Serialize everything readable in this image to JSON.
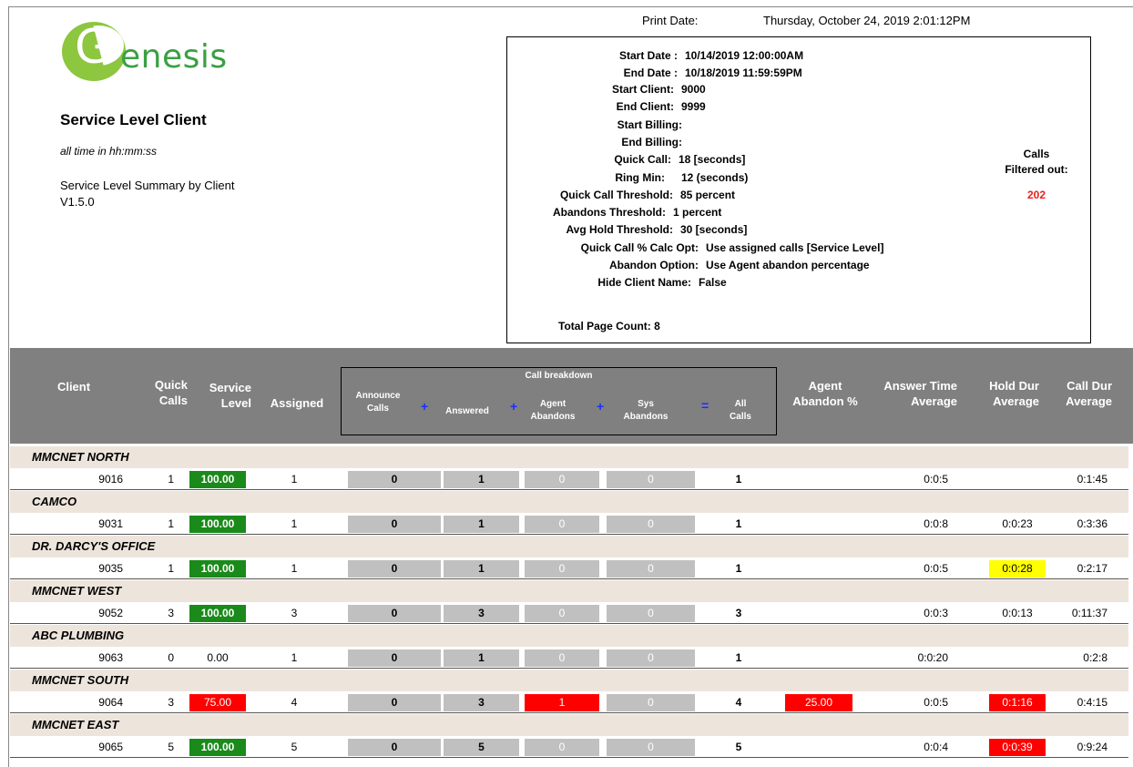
{
  "print": {
    "label": "Print Date:",
    "value": "Thursday, October 24, 2019   2:01:12PM"
  },
  "brand": {
    "logo_letter": "G",
    "logo_text": "enesis",
    "logo_color": "#8dc63f"
  },
  "report": {
    "title": "Service Level Client",
    "time_note": "all time in hh:mm:ss",
    "summary": "Service Level Summary by Client",
    "version": "V1.5.0"
  },
  "params": {
    "start_date": {
      "label": "Start Date :",
      "value": "10/14/2019  12:00:00AM"
    },
    "end_date": {
      "label": "End Date :",
      "value": "10/18/2019  11:59:59PM"
    },
    "start_client": {
      "label": "Start Client:",
      "value": "9000"
    },
    "end_client": {
      "label": "End Client:",
      "value": "9999"
    },
    "start_billing": {
      "label": "Start Billing:",
      "value": ""
    },
    "end_billing": {
      "label": "End Billing:",
      "value": ""
    },
    "quick_call": {
      "label": "Quick Call:",
      "value": "18 [seconds]"
    },
    "ring_min": {
      "label": "Ring Min:",
      "value": "12 (seconds)"
    },
    "quick_call_threshold": {
      "label": "Quick Call Threshold:",
      "value": "85 percent"
    },
    "abandons_threshold": {
      "label": "Abandons Threshold:",
      "value": "1 percent"
    },
    "avg_hold_threshold": {
      "label": "Avg Hold Threshold:",
      "value": "30 [seconds]"
    },
    "quick_call_calc_opt": {
      "label": "Quick Call % Calc Opt:",
      "value": "Use assigned calls [Service Level]"
    },
    "abandon_option": {
      "label": "Abandon Option:",
      "value": "Use Agent abandon percentage"
    },
    "hide_client_name": {
      "label": "Hide Client Name:",
      "value": "False"
    },
    "calls_filtered_line1": "Calls",
    "calls_filtered_line2": "Filtered out:",
    "calls_filtered_count": "202",
    "total_page_count_label": "Total Page Count:",
    "total_page_count": "8"
  },
  "columns": {
    "client": "Client",
    "quick_calls_1": "Quick",
    "quick_calls_2": "Calls",
    "service_level_1": "Service",
    "service_level_2": "Level",
    "assigned": "Assigned",
    "breakdown_title": "Call breakdown",
    "announce_1": "Announce",
    "announce_2": "Calls",
    "answered": "Answered",
    "agent_ab_1": "Agent",
    "agent_ab_2": "Abandons",
    "sys_ab_1": "Sys",
    "sys_ab_2": "Abandons",
    "all_1": "All",
    "all_2": "Calls",
    "plus": "+",
    "equals": "=",
    "agent_abandon_pct_1": "Agent",
    "agent_abandon_pct_2": "Abandon %",
    "answer_time_1": "Answer Time",
    "answer_time_2": "Average",
    "hold_dur_1": "Hold Dur",
    "hold_dur_2": "Average",
    "call_dur_1": "Call Dur",
    "call_dur_2": "Average"
  },
  "colors": {
    "good": "#1a8a1a",
    "bad": "#ff0000",
    "warn": "#ffff00",
    "header": "#808080",
    "group": "#ede5dc"
  },
  "groups": [
    {
      "name": "MMCNET NORTH",
      "client": "9016",
      "quick": "1",
      "service_level": "100.00",
      "sl_status": "good",
      "assigned": "1",
      "announce": "0",
      "answered": "1",
      "agent_ab": "0",
      "sys_ab": "0",
      "all": "1",
      "agent_ab_pct": "",
      "aap_status": "none",
      "answer_time": "0:0:5",
      "hold_dur": "",
      "hold_status": "none",
      "call_dur": "0:1:45"
    },
    {
      "name": "CAMCO",
      "client": "9031",
      "quick": "1",
      "service_level": "100.00",
      "sl_status": "good",
      "assigned": "1",
      "announce": "0",
      "answered": "1",
      "agent_ab": "0",
      "sys_ab": "0",
      "all": "1",
      "agent_ab_pct": "",
      "aap_status": "none",
      "answer_time": "0:0:8",
      "hold_dur": "0:0:23",
      "hold_status": "none",
      "call_dur": "0:3:36"
    },
    {
      "name": "DR. DARCY'S OFFICE",
      "client": "9035",
      "quick": "1",
      "service_level": "100.00",
      "sl_status": "good",
      "assigned": "1",
      "announce": "0",
      "answered": "1",
      "agent_ab": "0",
      "sys_ab": "0",
      "all": "1",
      "agent_ab_pct": "",
      "aap_status": "none",
      "answer_time": "0:0:5",
      "hold_dur": "0:0:28",
      "hold_status": "warn",
      "call_dur": "0:2:17"
    },
    {
      "name": "MMCNET WEST",
      "client": "9052",
      "quick": "3",
      "service_level": "100.00",
      "sl_status": "good",
      "assigned": "3",
      "announce": "0",
      "answered": "3",
      "agent_ab": "0",
      "sys_ab": "0",
      "all": "3",
      "agent_ab_pct": "",
      "aap_status": "none",
      "answer_time": "0:0:3",
      "hold_dur": "0:0:13",
      "hold_status": "none",
      "call_dur": "0:11:37"
    },
    {
      "name": "ABC PLUMBING",
      "client": "9063",
      "quick": "0",
      "service_level": "0.00",
      "sl_status": "none",
      "assigned": "1",
      "announce": "0",
      "answered": "1",
      "agent_ab": "0",
      "sys_ab": "0",
      "all": "1",
      "agent_ab_pct": "",
      "aap_status": "none",
      "answer_time": "0:0:20",
      "hold_dur": "",
      "hold_status": "none",
      "call_dur": "0:2:8"
    },
    {
      "name": "MMCNET SOUTH",
      "client": "9064",
      "quick": "3",
      "service_level": "75.00",
      "sl_status": "bad",
      "assigned": "4",
      "announce": "0",
      "answered": "3",
      "agent_ab": "1",
      "agent_ab_status": "bad",
      "sys_ab": "0",
      "all": "4",
      "agent_ab_pct": "25.00",
      "aap_status": "bad",
      "answer_time": "0:0:5",
      "hold_dur": "0:1:16",
      "hold_status": "bad",
      "call_dur": "0:4:15"
    },
    {
      "name": "MMCNET EAST",
      "client": "9065",
      "quick": "5",
      "service_level": "100.00",
      "sl_status": "good",
      "assigned": "5",
      "announce": "0",
      "answered": "5",
      "agent_ab": "0",
      "sys_ab": "0",
      "all": "5",
      "agent_ab_pct": "",
      "aap_status": "none",
      "answer_time": "0:0:4",
      "hold_dur": "0:0:39",
      "hold_status": "bad",
      "call_dur": "0:9:24"
    }
  ]
}
